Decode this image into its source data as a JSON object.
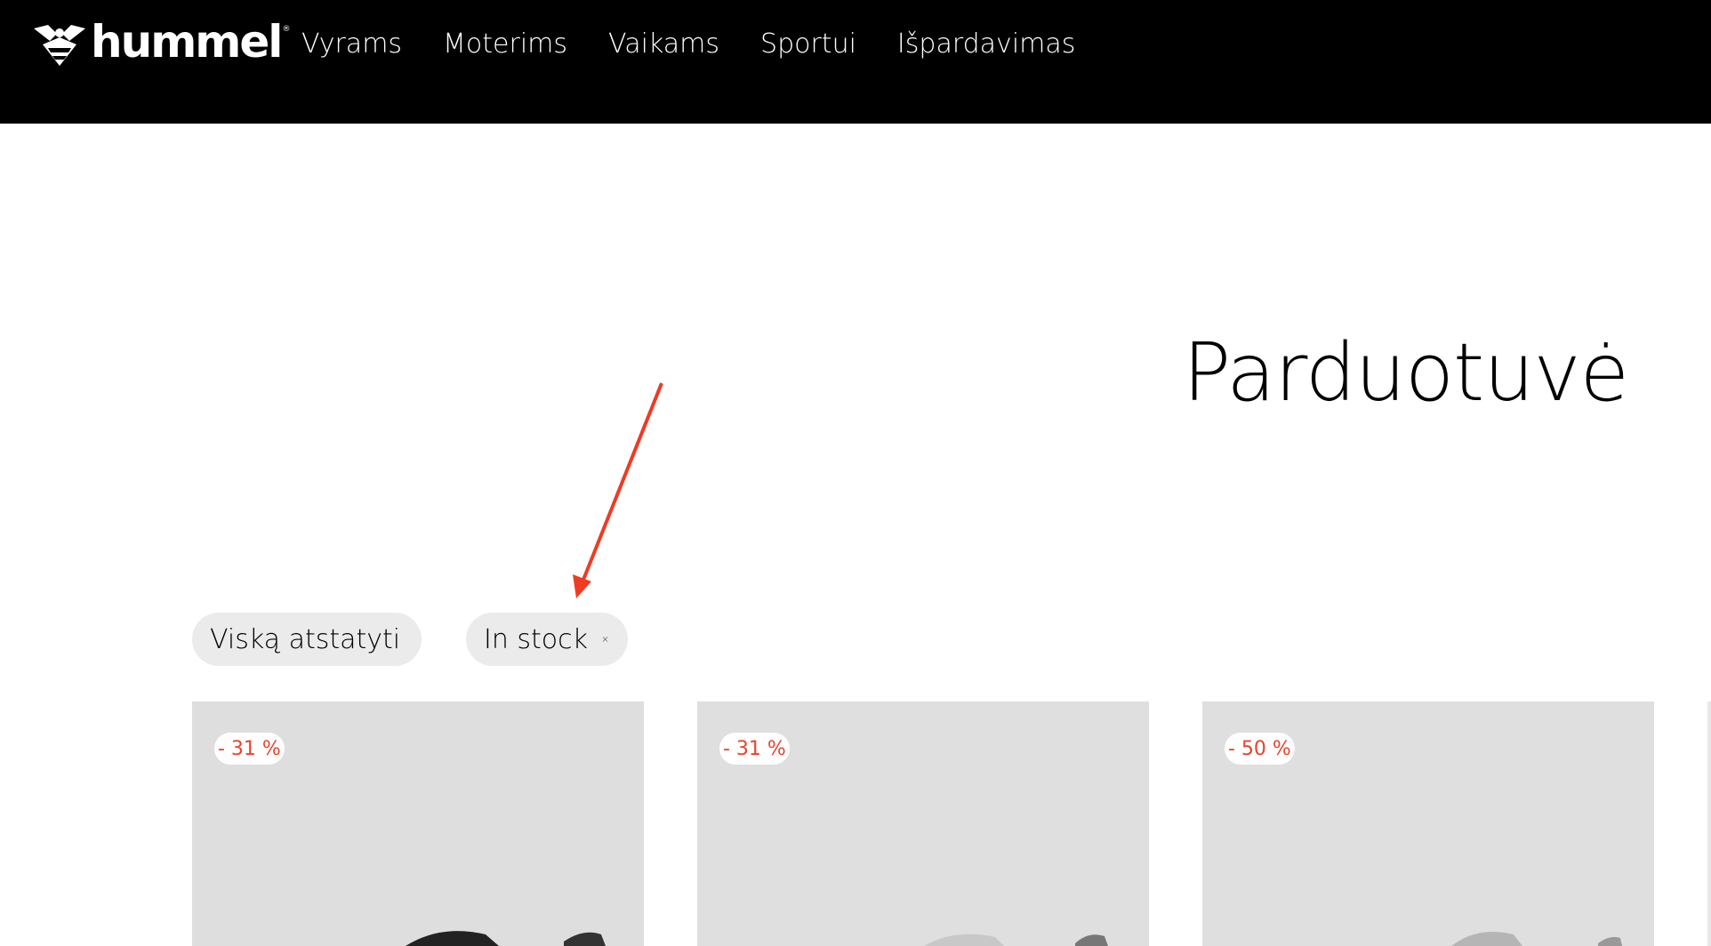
{
  "brand": {
    "logo_text": "hummel",
    "registered": "®"
  },
  "nav": {
    "items": [
      {
        "label": "Vyrams"
      },
      {
        "label": "Moterims"
      },
      {
        "label": "Vaikams"
      },
      {
        "label": "Sportui"
      },
      {
        "label": "Išpardavimas"
      }
    ]
  },
  "page": {
    "title": "Parduotuvė"
  },
  "filters": {
    "reset_label": "Viską atstatyti",
    "active": [
      {
        "label": "In stock"
      }
    ]
  },
  "products": [
    {
      "discount": "- 31 %",
      "shoe_color": "dark"
    },
    {
      "discount": "- 31 %",
      "shoe_color": "light"
    },
    {
      "discount": "- 50 %",
      "shoe_color": "light"
    }
  ],
  "colors": {
    "header_bg": "#000000",
    "chip_bg": "#ebebeb",
    "discount_red": "#e8432d",
    "annotation_arrow": "#f03a24",
    "card_bg": "#e0e0e0"
  },
  "icons": {
    "logo": "bee-logo-icon",
    "chip_close": "close-icon",
    "annotation": "arrow-icon"
  }
}
